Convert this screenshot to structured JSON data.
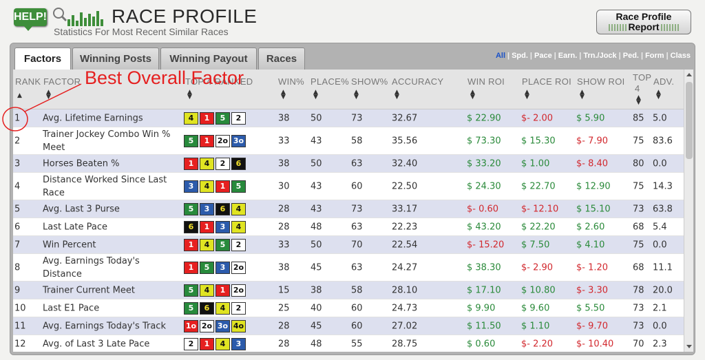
{
  "header": {
    "help_label": "HELP!",
    "title": "RACE PROFILE",
    "subtitle": "Statistics For Most Recent Similar Races",
    "report_button_line1": "Race Profile",
    "report_button_line2": "Report"
  },
  "tabs": [
    {
      "label": "Factors",
      "active": true
    },
    {
      "label": "Winning Posts",
      "active": false
    },
    {
      "label": "Winning Payout",
      "active": false
    },
    {
      "label": "Races",
      "active": false
    }
  ],
  "filters": [
    "All",
    "Spd.",
    "Pace",
    "Earn.",
    "Trn./Jock",
    "Ped.",
    "Form",
    "Class"
  ],
  "filter_selected": "All",
  "columns": {
    "rank": "RANK",
    "factor": "FACTOR",
    "top4": "TOP 4 RANKED",
    "win_pct": "WIN%",
    "place_pct": "PLACE%",
    "show_pct": "SHOW%",
    "accuracy": "ACCURACY",
    "win_roi": "WIN ROI",
    "place_roi": "PLACE ROI",
    "show_roi": "SHOW ROI",
    "top4_count_line1": "TOP",
    "top4_count_line2": "4",
    "adv": "ADV."
  },
  "annotation": "Best Overall Factor",
  "colors": {
    "positive": "#2a8a3a",
    "negative": "#d2282e",
    "odd_row": "#dde0ef",
    "annotation": "#e52020"
  },
  "rows": [
    {
      "rank": "1",
      "factor": "Avg. Lifetime Earnings",
      "top4": [
        [
          "4",
          "yellow"
        ],
        [
          "1",
          "red"
        ],
        [
          "5",
          "green"
        ],
        [
          "2",
          "white"
        ]
      ],
      "win": "38",
      "place": "50",
      "show": "73",
      "accuracy": "32.67",
      "win_roi": "$ 22.90",
      "win_neg": false,
      "place_roi": "$- 2.00",
      "place_neg": true,
      "show_roi": "$ 5.90",
      "show_neg": false,
      "top4c": "85",
      "adv": "5.0"
    },
    {
      "rank": "2",
      "factor": "Trainer Jockey Combo Win % Meet",
      "top4": [
        [
          "5",
          "green"
        ],
        [
          "1",
          "red"
        ],
        [
          "2o",
          "white"
        ],
        [
          "3o",
          "blue"
        ]
      ],
      "win": "33",
      "place": "43",
      "show": "58",
      "accuracy": "35.56",
      "win_roi": "$ 73.30",
      "win_neg": false,
      "place_roi": "$ 15.30",
      "place_neg": false,
      "show_roi": "$- 7.90",
      "show_neg": true,
      "top4c": "75",
      "adv": "83.6"
    },
    {
      "rank": "3",
      "factor": "Horses Beaten %",
      "top4": [
        [
          "1",
          "red"
        ],
        [
          "4",
          "yellow"
        ],
        [
          "2",
          "white"
        ],
        [
          "6",
          "black"
        ]
      ],
      "win": "38",
      "place": "50",
      "show": "63",
      "accuracy": "32.40",
      "win_roi": "$ 33.20",
      "win_neg": false,
      "place_roi": "$ 1.00",
      "place_neg": false,
      "show_roi": "$- 8.40",
      "show_neg": true,
      "top4c": "80",
      "adv": "0.0"
    },
    {
      "rank": "4",
      "factor": "Distance Worked Since Last Race",
      "top4": [
        [
          "3",
          "blue"
        ],
        [
          "4",
          "yellow"
        ],
        [
          "1",
          "red"
        ],
        [
          "5",
          "green"
        ]
      ],
      "win": "30",
      "place": "43",
      "show": "60",
      "accuracy": "22.50",
      "win_roi": "$ 24.30",
      "win_neg": false,
      "place_roi": "$ 22.70",
      "place_neg": false,
      "show_roi": "$ 12.90",
      "show_neg": false,
      "top4c": "75",
      "adv": "14.3"
    },
    {
      "rank": "5",
      "factor": "Avg. Last 3 Purse",
      "top4": [
        [
          "5",
          "green"
        ],
        [
          "3",
          "blue"
        ],
        [
          "6",
          "black"
        ],
        [
          "4",
          "yellow"
        ]
      ],
      "win": "28",
      "place": "43",
      "show": "73",
      "accuracy": "33.17",
      "win_roi": "$- 0.60",
      "win_neg": true,
      "place_roi": "$- 12.10",
      "place_neg": true,
      "show_roi": "$ 15.10",
      "show_neg": false,
      "top4c": "73",
      "adv": "63.8"
    },
    {
      "rank": "6",
      "factor": "Last Late Pace",
      "top4": [
        [
          "6",
          "black"
        ],
        [
          "1",
          "red"
        ],
        [
          "3",
          "blue"
        ],
        [
          "4",
          "yellow"
        ]
      ],
      "win": "28",
      "place": "48",
      "show": "63",
      "accuracy": "22.23",
      "win_roi": "$ 43.20",
      "win_neg": false,
      "place_roi": "$ 22.20",
      "place_neg": false,
      "show_roi": "$ 2.60",
      "show_neg": false,
      "top4c": "68",
      "adv": "5.4"
    },
    {
      "rank": "7",
      "factor": "Win Percent",
      "top4": [
        [
          "1",
          "red"
        ],
        [
          "4",
          "yellow"
        ],
        [
          "5",
          "green"
        ],
        [
          "2",
          "white"
        ]
      ],
      "win": "33",
      "place": "50",
      "show": "70",
      "accuracy": "22.54",
      "win_roi": "$- 15.20",
      "win_neg": true,
      "place_roi": "$ 7.50",
      "place_neg": false,
      "show_roi": "$ 4.10",
      "show_neg": false,
      "top4c": "75",
      "adv": "0.0"
    },
    {
      "rank": "8",
      "factor": "Avg. Earnings Today's Distance",
      "top4": [
        [
          "1",
          "red"
        ],
        [
          "5",
          "green"
        ],
        [
          "3",
          "blue"
        ],
        [
          "2o",
          "white"
        ]
      ],
      "win": "38",
      "place": "45",
      "show": "63",
      "accuracy": "24.27",
      "win_roi": "$ 38.30",
      "win_neg": false,
      "place_roi": "$- 2.90",
      "place_neg": true,
      "show_roi": "$- 1.20",
      "show_neg": true,
      "top4c": "68",
      "adv": "11.1"
    },
    {
      "rank": "9",
      "factor": "Trainer Current Meet",
      "top4": [
        [
          "5",
          "green"
        ],
        [
          "4",
          "yellow"
        ],
        [
          "1",
          "red"
        ],
        [
          "2o",
          "white"
        ]
      ],
      "win": "15",
      "place": "38",
      "show": "58",
      "accuracy": "28.10",
      "win_roi": "$ 17.10",
      "win_neg": false,
      "place_roi": "$ 10.80",
      "place_neg": false,
      "show_roi": "$- 3.30",
      "show_neg": true,
      "top4c": "78",
      "adv": "20.0"
    },
    {
      "rank": "10",
      "factor": "Last E1 Pace",
      "top4": [
        [
          "5",
          "green"
        ],
        [
          "6",
          "black"
        ],
        [
          "4",
          "yellow"
        ],
        [
          "2",
          "white"
        ]
      ],
      "win": "25",
      "place": "40",
      "show": "60",
      "accuracy": "24.73",
      "win_roi": "$ 9.90",
      "win_neg": false,
      "place_roi": "$ 9.60",
      "place_neg": false,
      "show_roi": "$ 5.50",
      "show_neg": false,
      "top4c": "73",
      "adv": "2.1"
    },
    {
      "rank": "11",
      "factor": "Avg. Earnings Today's Track",
      "top4": [
        [
          "1o",
          "red"
        ],
        [
          "2o",
          "white"
        ],
        [
          "3o",
          "blue"
        ],
        [
          "4o",
          "yellow"
        ]
      ],
      "win": "28",
      "place": "45",
      "show": "60",
      "accuracy": "27.02",
      "win_roi": "$ 11.50",
      "win_neg": false,
      "place_roi": "$ 1.10",
      "place_neg": false,
      "show_roi": "$- 9.70",
      "show_neg": true,
      "top4c": "73",
      "adv": "0.0"
    },
    {
      "rank": "12",
      "factor": "Avg. of Last 3 Late Pace",
      "top4": [
        [
          "2",
          "white"
        ],
        [
          "1",
          "red"
        ],
        [
          "4",
          "yellow"
        ],
        [
          "3",
          "blue"
        ]
      ],
      "win": "28",
      "place": "48",
      "show": "55",
      "accuracy": "28.75",
      "win_roi": "$ 0.60",
      "win_neg": false,
      "place_roi": "$- 2.20",
      "place_neg": true,
      "show_roi": "$- 10.40",
      "show_neg": true,
      "top4c": "70",
      "adv": "2.3"
    }
  ]
}
